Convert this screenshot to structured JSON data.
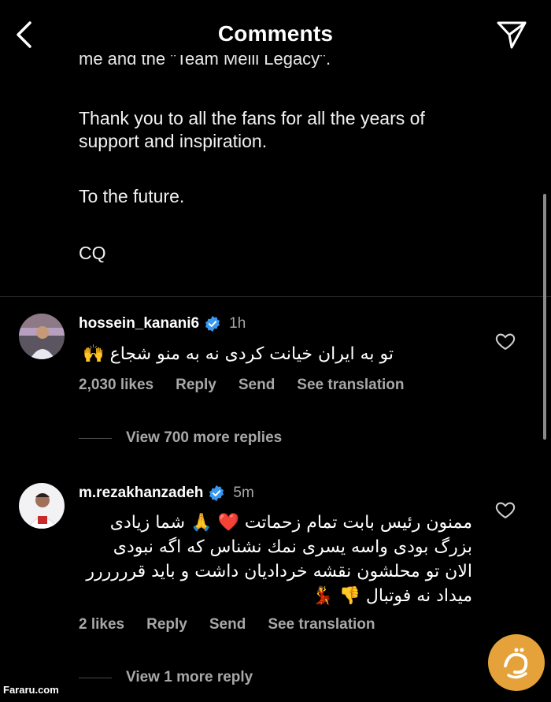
{
  "header": {
    "title": "Comments"
  },
  "post": {
    "cut_line": "me and the \"Team Melli Legacy\".",
    "p1_l1": "Thank you to all the fans for all the years of",
    "p1_l2": "support and inspiration.",
    "p2": "To the future.",
    "p3": "CQ"
  },
  "comments": [
    {
      "username": "hossein_kanani6",
      "time": "1h",
      "lines": [
        "تو به ایران خیانت کردی نه به منو شجاع 🙌"
      ],
      "likes": "2,030 likes",
      "reply": "Reply",
      "send": "Send",
      "translate": "See translation",
      "more_replies": "View 700 more replies"
    },
    {
      "username": "m.rezakhanzadeh",
      "time": "5m",
      "lines": [
        "ممنون رئیس بابت تمام زحماتت ❤️ 🙏 شما زیادی",
        "بزرگ بودی واسه یسری نمك نشناس که اگه نبودی",
        "الان تو محلشون نقشه خردادیان داشت و باید قرررررر",
        "میداد نه فوتبال 👎 💃"
      ],
      "likes": "2 likes",
      "reply": "Reply",
      "send": "Send",
      "translate": "See translation",
      "more_replies": "View 1 more reply"
    }
  ],
  "watermark": "Fararu.com",
  "colors": {
    "background": "#000000",
    "secondary_text": "#a8a8a8",
    "verified": "#3897f0",
    "logo": "#e5a23a"
  }
}
